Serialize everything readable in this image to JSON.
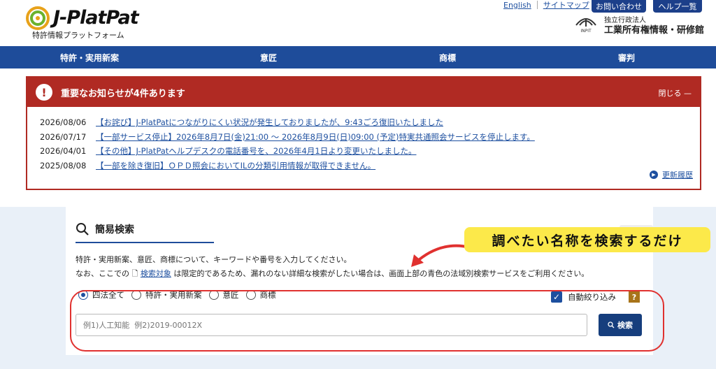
{
  "header": {
    "logo_text": "J-PlatPat",
    "logo_sub": "特許情報プラットフォーム",
    "links": [
      "English",
      "サイトマップ"
    ],
    "buttons": [
      "お問い合わせ",
      "ヘルプ一覧"
    ],
    "org_small": "独立行政法人",
    "org_name": "工業所有権情報・研修館",
    "org_logo_text": "INPIT"
  },
  "nav": {
    "items": [
      "特許・実用新案",
      "意匠",
      "商標",
      "審判"
    ]
  },
  "notice": {
    "title": "重要なお知らせが4件あります",
    "close_label": "閉じる —",
    "items": [
      {
        "date": "2026/08/06",
        "text": "【お詫び】J-PlatPatにつながりにくい状況が発生しておりましたが、9:43ごろ復旧いたしました"
      },
      {
        "date": "2026/07/17",
        "text": "【一部サービス停止】2026年8月7日(金)21:00 〜 2026年8月9日(日)09:00 (予定)特実共通照会サービスを停止します。"
      },
      {
        "date": "2026/04/01",
        "text": "【その他】J-PlatPatヘルプデスクの電話番号を、2026年4月1日より変更いたしました。"
      },
      {
        "date": "2025/08/08",
        "text": "【一部を除き復旧】ＯＰＤ照会においてILの分類引用情報が取得できません。"
      }
    ],
    "history_label": "更新履歴"
  },
  "search": {
    "title": "簡易検索",
    "desc_line1": "特許・実用新案、意匠、商標について、キーワードや番号を入力してください。",
    "desc_line2_pre": "なお、ここでの",
    "desc_line2_link": "検索対象",
    "desc_line2_post": "は限定的であるため、漏れのない詳細な検索がしたい場合は、画面上部の青色の法域別検索サービスをご利用ください。",
    "radios": [
      {
        "label": "四法全て",
        "checked": true
      },
      {
        "label": "特許・実用新案",
        "checked": false
      },
      {
        "label": "意匠",
        "checked": false
      },
      {
        "label": "商標",
        "checked": false
      }
    ],
    "auto_label": "自動絞り込み",
    "auto_checked": true,
    "help_label": "?",
    "input_placeholder": "例1)人工知能  例2)2019-00012X",
    "input_value": "",
    "search_button": "検索"
  },
  "annotation": {
    "callout_text": "調べたい名称を検索するだけ",
    "callout_color": "#fce94a",
    "highlight_color": "#e0312f"
  },
  "colors": {
    "nav_bg": "#1e4c9a",
    "notice_red": "#b02a23",
    "link_blue": "#1d4f9f",
    "search_bg": "#e9f0f8"
  }
}
